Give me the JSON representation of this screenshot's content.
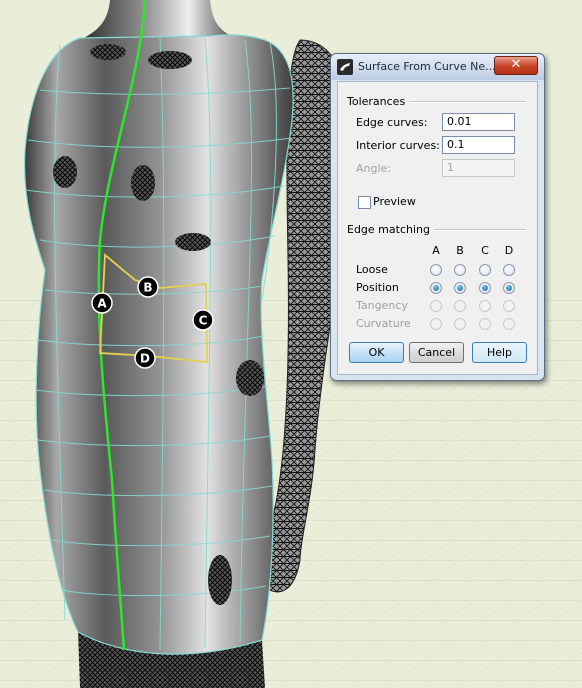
{
  "viewport": {
    "callouts": [
      "A",
      "B",
      "C",
      "D"
    ],
    "colors": {
      "background": "#eaeed9",
      "isocurves": "#86d9d3",
      "seam": "#2ee52e",
      "selected_curve": "#e3d14a",
      "surface": "#8a8a8a"
    }
  },
  "dialog": {
    "title": "Surface From Curve Ne...",
    "close_glyph": "✕",
    "tolerances": {
      "heading": "Tolerances",
      "edge_curves_label": "Edge curves:",
      "edge_curves_value": "0.01",
      "interior_curves_label": "Interior curves:",
      "interior_curves_value": "0.1",
      "angle_label": "Angle:",
      "angle_value": "1"
    },
    "preview_label": "Preview",
    "preview_checked": false,
    "edge_matching": {
      "heading": "Edge matching",
      "columns": [
        "A",
        "B",
        "C",
        "D"
      ],
      "rows": [
        {
          "label": "Loose",
          "enabled": true,
          "checked": [
            false,
            false,
            false,
            false
          ]
        },
        {
          "label": "Position",
          "enabled": true,
          "checked": [
            true,
            true,
            true,
            true
          ]
        },
        {
          "label": "Tangency",
          "enabled": false,
          "checked": [
            false,
            false,
            false,
            false
          ]
        },
        {
          "label": "Curvature",
          "enabled": false,
          "checked": [
            false,
            false,
            false,
            false
          ]
        }
      ]
    },
    "buttons": {
      "ok": "OK",
      "cancel": "Cancel",
      "help": "Help"
    }
  }
}
